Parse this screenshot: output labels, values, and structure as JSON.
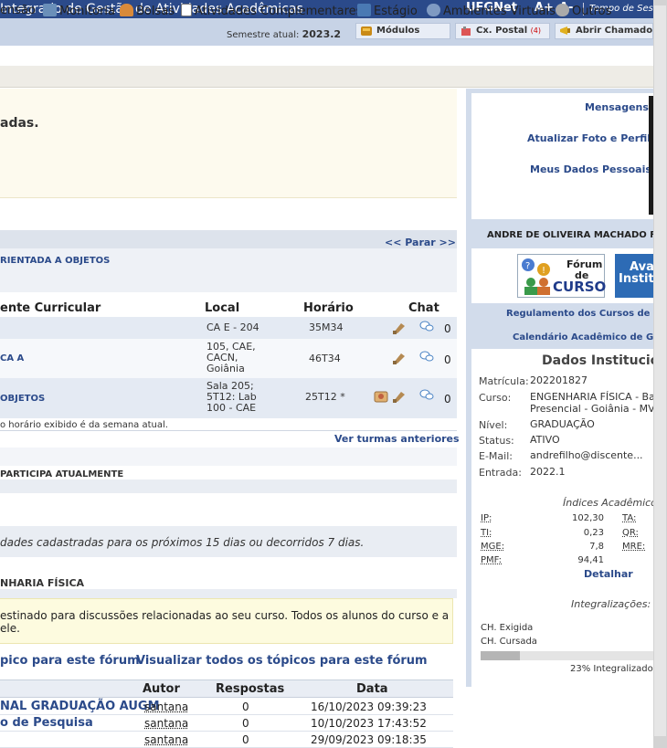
{
  "header": {
    "title": "Integrado de Gestão de Atividades Acadêmicas",
    "ufgnet": "UFGNet",
    "font_increase": "A+",
    "font_decrease": "A-",
    "session_label": "Tempo de Ses"
  },
  "subheader": {
    "semestre_label": "Semestre atual:",
    "semestre_value": "2023.2",
    "modulos": "Módulos",
    "cx_postal": "Cx. Postal",
    "cx_postal_count": "(4)",
    "abrir_chamado": "Abrir Chamado"
  },
  "menu": {
    "items": [
      "ensão",
      "Monitoria",
      "Bolsas",
      "Atividades Complementares",
      "Estágio",
      "Ambientes Virtuais",
      "Outros"
    ]
  },
  "notice": {
    "text": "adas."
  },
  "turmas": {
    "parar": "<< Parar >>",
    "course_title": "RIENTADA A OBJETOS",
    "headers": {
      "componente": "ente Curricular",
      "local": "Local",
      "horario": "Horário",
      "chat": "Chat"
    },
    "rows": [
      {
        "componente": "",
        "local": [
          "CA E - 204"
        ],
        "horario": "35M34",
        "chat_count": "0"
      },
      {
        "componente": "CA A",
        "local": [
          "105, CAE,",
          "CACN,",
          "Goiânia"
        ],
        "horario": "46T34",
        "chat_count": "0"
      },
      {
        "componente": "OBJETOS",
        "local": [
          "Sala 205;",
          "5T12: Lab",
          "100 - CAE"
        ],
        "horario": "25T12 *",
        "chat_count": "0"
      }
    ],
    "footnote": "o horário exibido é da semana atual.",
    "ver_anteriores": "Ver turmas anteriores"
  },
  "sections": {
    "participa": "PARTICIPA ATUALMENTE",
    "atividades_msg": "dades cadastradas para os próximos 15 dias ou decorridos 7 dias.",
    "forum_heading": "NHARIA FÍSICA"
  },
  "forum": {
    "desc_line1": "estinado para discussões relacionadas ao seu curso. Todos os alunos do curso e a",
    "desc_line2": "ele.",
    "new_topic": "pico para este fórum",
    "view_all": "Visualizar todos os tópicos para este fórum",
    "headers": {
      "autor": "Autor",
      "respostas": "Respostas",
      "data": "Data"
    },
    "rows": [
      {
        "titulo": "NAL GRADUAÇÃO AUGM",
        "autor": "santana",
        "respostas": "0",
        "data": "16/10/2023 09:39:23"
      },
      {
        "titulo": "o de Pesquisa",
        "autor": "santana",
        "respostas": "0",
        "data": "10/10/2023 17:43:52"
      },
      {
        "titulo": "",
        "autor": "santana",
        "respostas": "0",
        "data": "29/09/2023 09:18:35"
      }
    ]
  },
  "sidebar": {
    "mensagens": "Mensagens",
    "atualizar_foto": "Atualizar Foto e Perfil",
    "meus_dados": "Meus Dados Pessoais",
    "student_name": "ANDRE DE OLIVEIRA MACHADO F",
    "forum_banner": {
      "l1": "Fórum",
      "l2": "de",
      "l3": "CURSO"
    },
    "avai_banner": {
      "l1": "Ava",
      "l2": "Instit"
    },
    "regulamento": "Regulamento dos Cursos de",
    "calendario": "Calendário Acadêmico de G",
    "dados_title": "Dados Institucio",
    "dados": {
      "matricula_label": "Matrícula:",
      "matricula": "202201827",
      "curso_label": "Curso:",
      "curso": [
        "ENGENHARIA FÍSICA - Ba",
        "Presencial - Goiânia - MV"
      ],
      "nivel_label": "Nível:",
      "nivel": "GRADUAÇÃO",
      "status_label": "Status:",
      "status": "ATIVO",
      "email_label": "E-Mail:",
      "email": "andrefilho@discente...",
      "entrada_label": "Entrada:",
      "entrada": "2022.1"
    },
    "indices_title": "Índices Acadêmico",
    "indices": {
      "ip_l": "IP:",
      "ip": "102,30",
      "ta_l": "TA:",
      "ti_l": "TI:",
      "ti": "0,23",
      "qr_l": "QR:",
      "mge_l": "MGE:",
      "mge": "7,8",
      "mre_l": "MRE:",
      "pmf_l": "PMF:",
      "pmf": "94,41"
    },
    "detalhar": "Detalhar",
    "integralizacoes": "Integralizações:",
    "ch_exigida": "CH. Exigida",
    "ch_cursada": "CH. Cursada",
    "integralizado_pct": 0.23,
    "integralizado": "23% Integralizado"
  },
  "colors": {
    "header": "#2b4a8a",
    "subheader": "#c7d3e6",
    "sidebar": "#d2dceb",
    "link": "#2b4a8a"
  },
  "icons": [
    "modulos-cube-icon",
    "cx-postal-icon",
    "abrir-chamado-icon",
    "monitoria-icon",
    "bolsas-icon",
    "atividades-icon",
    "estagio-icon",
    "ambientes-icon",
    "outros-icon",
    "chat-icon",
    "edit-icon",
    "forum-icon"
  ]
}
